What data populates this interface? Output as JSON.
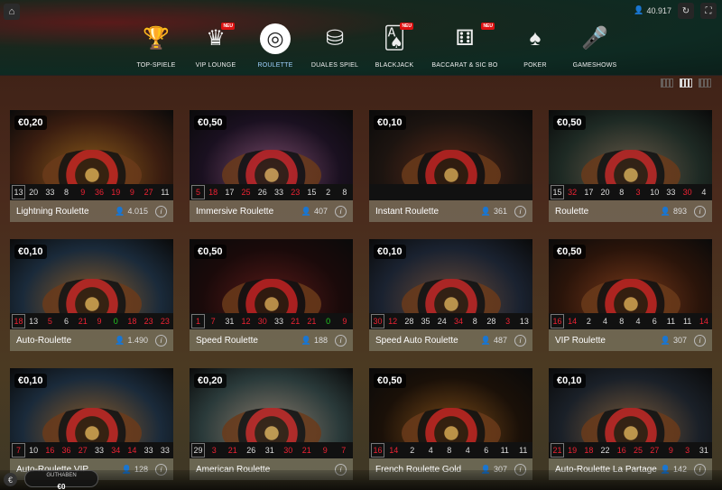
{
  "topbar": {
    "home_icon": "home-icon",
    "balance": "40.917",
    "balance_icon": "person-icon",
    "history_icon": "history-icon",
    "fullscreen_icon": "fullscreen-icon"
  },
  "nav": [
    {
      "label": "TOP-SPIELE",
      "icon": "podium-icon",
      "glyph": "🏆",
      "neu": ""
    },
    {
      "label": "VIP LOUNGE",
      "icon": "crown-icon",
      "glyph": "♛",
      "neu": "NEU"
    },
    {
      "label": "ROULETTE",
      "icon": "roulette-wheel-icon",
      "glyph": "◎",
      "neu": ""
    },
    {
      "label": "DUALES SPIEL",
      "icon": "chips-icon",
      "glyph": "⛁",
      "neu": ""
    },
    {
      "label": "BLACKJACK",
      "icon": "cards-icon",
      "glyph": "🂡",
      "neu": "NEU"
    },
    {
      "label": "BACCARAT & SIC BO",
      "icon": "dice-icon",
      "glyph": "⚅",
      "neu": "NEU"
    },
    {
      "label": "POKER",
      "icon": "poker-cards-icon",
      "glyph": "♠",
      "neu": ""
    },
    {
      "label": "GAMESHOWS",
      "icon": "microphone-icon",
      "glyph": "🎤",
      "neu": ""
    }
  ],
  "active_nav": "ROULETTE",
  "games": [
    {
      "bet": "€0,20",
      "name": "Lightning Roulette",
      "players": "4.015",
      "bg": "#3a1d10",
      "bg2": "#8a5a1a",
      "results": [
        [
          "13",
          "black"
        ],
        [
          "20",
          "black"
        ],
        [
          "33",
          "black"
        ],
        [
          "8",
          "black"
        ],
        [
          "9",
          "red"
        ],
        [
          "36",
          "red"
        ],
        [
          "19",
          "red"
        ],
        [
          "9",
          "red"
        ],
        [
          "27",
          "red"
        ],
        [
          "11",
          "black"
        ]
      ]
    },
    {
      "bet": "€0,50",
      "name": "Immersive Roulette",
      "players": "407",
      "bg": "#1a1020",
      "bg2": "#7a4a6a",
      "results": [
        [
          "5",
          "red"
        ],
        [
          "18",
          "red"
        ],
        [
          "17",
          "black"
        ],
        [
          "25",
          "red"
        ],
        [
          "26",
          "black"
        ],
        [
          "33",
          "black"
        ],
        [
          "23",
          "red"
        ],
        [
          "15",
          "black"
        ],
        [
          "2",
          "black"
        ],
        [
          "8",
          "black"
        ]
      ]
    },
    {
      "bet": "€0,10",
      "name": "Instant Roulette",
      "players": "361",
      "bg": "#1c1410",
      "bg2": "#5a2a18",
      "results": []
    },
    {
      "bet": "€0,50",
      "name": "Roulette",
      "players": "893",
      "bg": "#1e2a24",
      "bg2": "#6a5a48",
      "results": [
        [
          "15",
          "black"
        ],
        [
          "32",
          "red"
        ],
        [
          "17",
          "black"
        ],
        [
          "20",
          "black"
        ],
        [
          "8",
          "black"
        ],
        [
          "3",
          "red"
        ],
        [
          "10",
          "black"
        ],
        [
          "33",
          "black"
        ],
        [
          "30",
          "red"
        ],
        [
          "4",
          "black"
        ]
      ]
    },
    {
      "bet": "€0,10",
      "name": "Auto-Roulette",
      "players": "1.490",
      "bg": "#1a2a3a",
      "bg2": "#8a5a28",
      "results": [
        [
          "18",
          "red"
        ],
        [
          "13",
          "black"
        ],
        [
          "5",
          "red"
        ],
        [
          "6",
          "black"
        ],
        [
          "21",
          "red"
        ],
        [
          "9",
          "red"
        ],
        [
          "0",
          "green"
        ],
        [
          "18",
          "red"
        ],
        [
          "23",
          "red"
        ],
        [
          "23",
          "red"
        ]
      ]
    },
    {
      "bet": "€0,50",
      "name": "Speed Roulette",
      "players": "188",
      "bg": "#1a0a0a",
      "bg2": "#5a1a18",
      "results": [
        [
          "1",
          "red"
        ],
        [
          "7",
          "red"
        ],
        [
          "31",
          "black"
        ],
        [
          "12",
          "red"
        ],
        [
          "30",
          "red"
        ],
        [
          "33",
          "black"
        ],
        [
          "21",
          "red"
        ],
        [
          "21",
          "red"
        ],
        [
          "0",
          "green"
        ],
        [
          "9",
          "red"
        ]
      ]
    },
    {
      "bet": "€0,10",
      "name": "Speed Auto Roulette",
      "players": "487",
      "bg": "#1a2230",
      "bg2": "#6a4a38",
      "results": [
        [
          "30",
          "red"
        ],
        [
          "12",
          "red"
        ],
        [
          "28",
          "black"
        ],
        [
          "35",
          "black"
        ],
        [
          "24",
          "black"
        ],
        [
          "34",
          "red"
        ],
        [
          "8",
          "black"
        ],
        [
          "28",
          "black"
        ],
        [
          "3",
          "red"
        ],
        [
          "13",
          "black"
        ]
      ]
    },
    {
      "bet": "€0,50",
      "name": "VIP Roulette",
      "players": "307",
      "bg": "#2a140a",
      "bg2": "#7a3a1a",
      "results": [
        [
          "16",
          "red"
        ],
        [
          "14",
          "red"
        ],
        [
          "2",
          "black"
        ],
        [
          "4",
          "black"
        ],
        [
          "8",
          "black"
        ],
        [
          "4",
          "black"
        ],
        [
          "6",
          "black"
        ],
        [
          "11",
          "black"
        ],
        [
          "11",
          "black"
        ],
        [
          "14",
          "red"
        ]
      ]
    },
    {
      "bet": "€0,10",
      "name": "Auto-Roulette VIP",
      "players": "128",
      "bg": "#1a2a3a",
      "bg2": "#8a5a28",
      "results": [
        [
          "7",
          "red"
        ],
        [
          "10",
          "black"
        ],
        [
          "16",
          "red"
        ],
        [
          "36",
          "red"
        ],
        [
          "27",
          "red"
        ],
        [
          "33",
          "black"
        ],
        [
          "34",
          "red"
        ],
        [
          "14",
          "red"
        ],
        [
          "33",
          "black"
        ],
        [
          "33",
          "black"
        ]
      ]
    },
    {
      "bet": "€0,20",
      "name": "American Roulette",
      "players": "",
      "bg": "#2a3a3a",
      "bg2": "#8a7a6a",
      "results": [
        [
          "29",
          "black"
        ],
        [
          "3",
          "red"
        ],
        [
          "21",
          "red"
        ],
        [
          "26",
          "black"
        ],
        [
          "31",
          "black"
        ],
        [
          "30",
          "red"
        ],
        [
          "21",
          "red"
        ],
        [
          "9",
          "red"
        ],
        [
          "7",
          "red"
        ]
      ]
    },
    {
      "bet": "€0,50",
      "name": "French Roulette Gold",
      "players": "307",
      "bg": "#1a1008",
      "bg2": "#7a4a18",
      "results": [
        [
          "16",
          "red"
        ],
        [
          "14",
          "red"
        ],
        [
          "2",
          "black"
        ],
        [
          "4",
          "black"
        ],
        [
          "8",
          "black"
        ],
        [
          "4",
          "black"
        ],
        [
          "6",
          "black"
        ],
        [
          "11",
          "black"
        ],
        [
          "11",
          "black"
        ]
      ]
    },
    {
      "bet": "€0,10",
      "name": "Auto-Roulette La Partage",
      "players": "142",
      "bg": "#1a2028",
      "bg2": "#7a5a3a",
      "results": [
        [
          "21",
          "red"
        ],
        [
          "19",
          "red"
        ],
        [
          "18",
          "red"
        ],
        [
          "22",
          "black"
        ],
        [
          "16",
          "red"
        ],
        [
          "25",
          "red"
        ],
        [
          "27",
          "red"
        ],
        [
          "9",
          "red"
        ],
        [
          "3",
          "red"
        ],
        [
          "31",
          "black"
        ]
      ]
    }
  ],
  "wallet": {
    "label": "GUTHABEN",
    "value": "€0",
    "currency_icon": "euro-icon"
  }
}
